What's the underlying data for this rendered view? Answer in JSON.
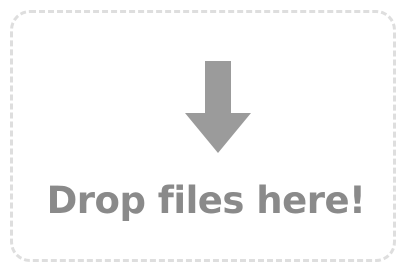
{
  "dropzone": {
    "label": "Drop files here!",
    "icon": "arrow-down-icon",
    "colors": {
      "border": "#dedede",
      "icon": "#9b9b9b",
      "text": "#8a8a8a"
    }
  }
}
